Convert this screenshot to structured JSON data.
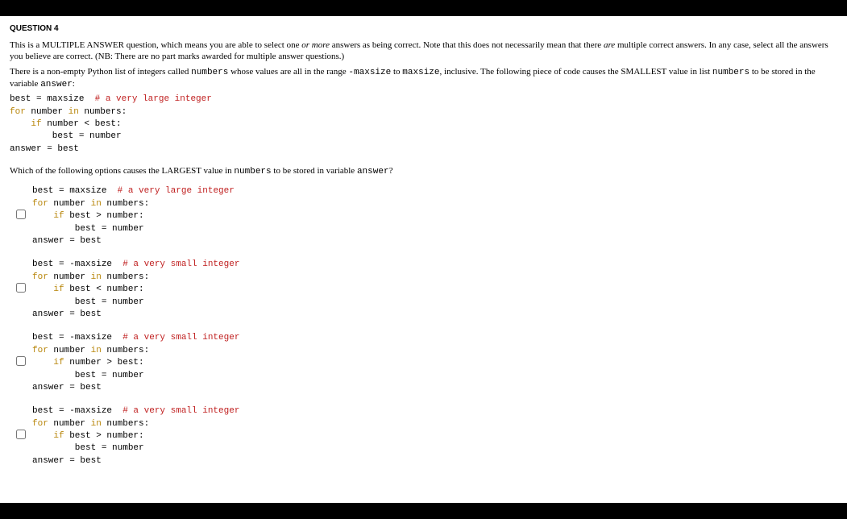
{
  "question_header": "QUESTION 4",
  "intro1_a": "This is a MULTIPLE ANSWER question, which means you are able to select one ",
  "intro1_b": "or more",
  "intro1_c": " answers as being correct.  Note that this does not necessarily mean that there ",
  "intro1_d": "are",
  "intro1_e": " multiple correct answers.  In any case, select all the answers you believe are correct.  (NB: There are no part marks awarded for multiple answer questions.)",
  "intro2_a": "There is a non-empty Python list of integers called ",
  "intro2_b": "numbers",
  "intro2_c": " whose values are all in the range ",
  "intro2_d": "-maxsize",
  "intro2_e": " to ",
  "intro2_f": "maxsize",
  "intro2_g": ", inclusive.  The following piece of code causes the SMALLEST value in list ",
  "intro2_h": "numbers",
  "intro2_i": " to be stored in the variable ",
  "intro2_j": "answer",
  "intro2_k": ":",
  "samp_l1a": "best = maxsize  ",
  "samp_l1b": "# a very large integer",
  "samp_l2a": "for",
  "samp_l2b": " number ",
  "samp_l2c": "in",
  "samp_l2d": " numbers:",
  "samp_l3a": "    ",
  "samp_l3b": "if",
  "samp_l3c": " number < best:",
  "samp_l4": "        best = number",
  "samp_l5": "answer = best",
  "prompt_a": "Which of the following options causes the LARGEST value in ",
  "prompt_b": "numbers",
  "prompt_c": "  to be stored in variable ",
  "prompt_d": "answer",
  "prompt_e": "?",
  "optA": {
    "l1a": "best = maxsize  ",
    "l1b": "# a very large integer",
    "l2a": "for",
    "l2b": " number ",
    "l2c": "in",
    "l2d": " numbers:",
    "l3a": "    ",
    "l3b": "if",
    "l3c": " best > number:",
    "l4": "        best = number",
    "l5": "answer = best"
  },
  "optB": {
    "l1a": "best = -maxsize  ",
    "l1b": "# a very small integer",
    "l2a": "for",
    "l2b": " number ",
    "l2c": "in",
    "l2d": " numbers:",
    "l3a": "    ",
    "l3b": "if",
    "l3c": " best < number:",
    "l4": "        best = number",
    "l5": "answer = best"
  },
  "optC": {
    "l1a": "best = -maxsize  ",
    "l1b": "# a very small integer",
    "l2a": "for",
    "l2b": " number ",
    "l2c": "in",
    "l2d": " numbers:",
    "l3a": "    ",
    "l3b": "if",
    "l3c": " number > best:",
    "l4": "        best = number",
    "l5": "answer = best"
  },
  "optD": {
    "l1a": "best = -maxsize  ",
    "l1b": "# a very small integer",
    "l2a": "for",
    "l2b": " number ",
    "l2c": "in",
    "l2d": " numbers:",
    "l3a": "    ",
    "l3b": "if",
    "l3c": " best > number:",
    "l4": "        best = number",
    "l5": "answer = best"
  }
}
